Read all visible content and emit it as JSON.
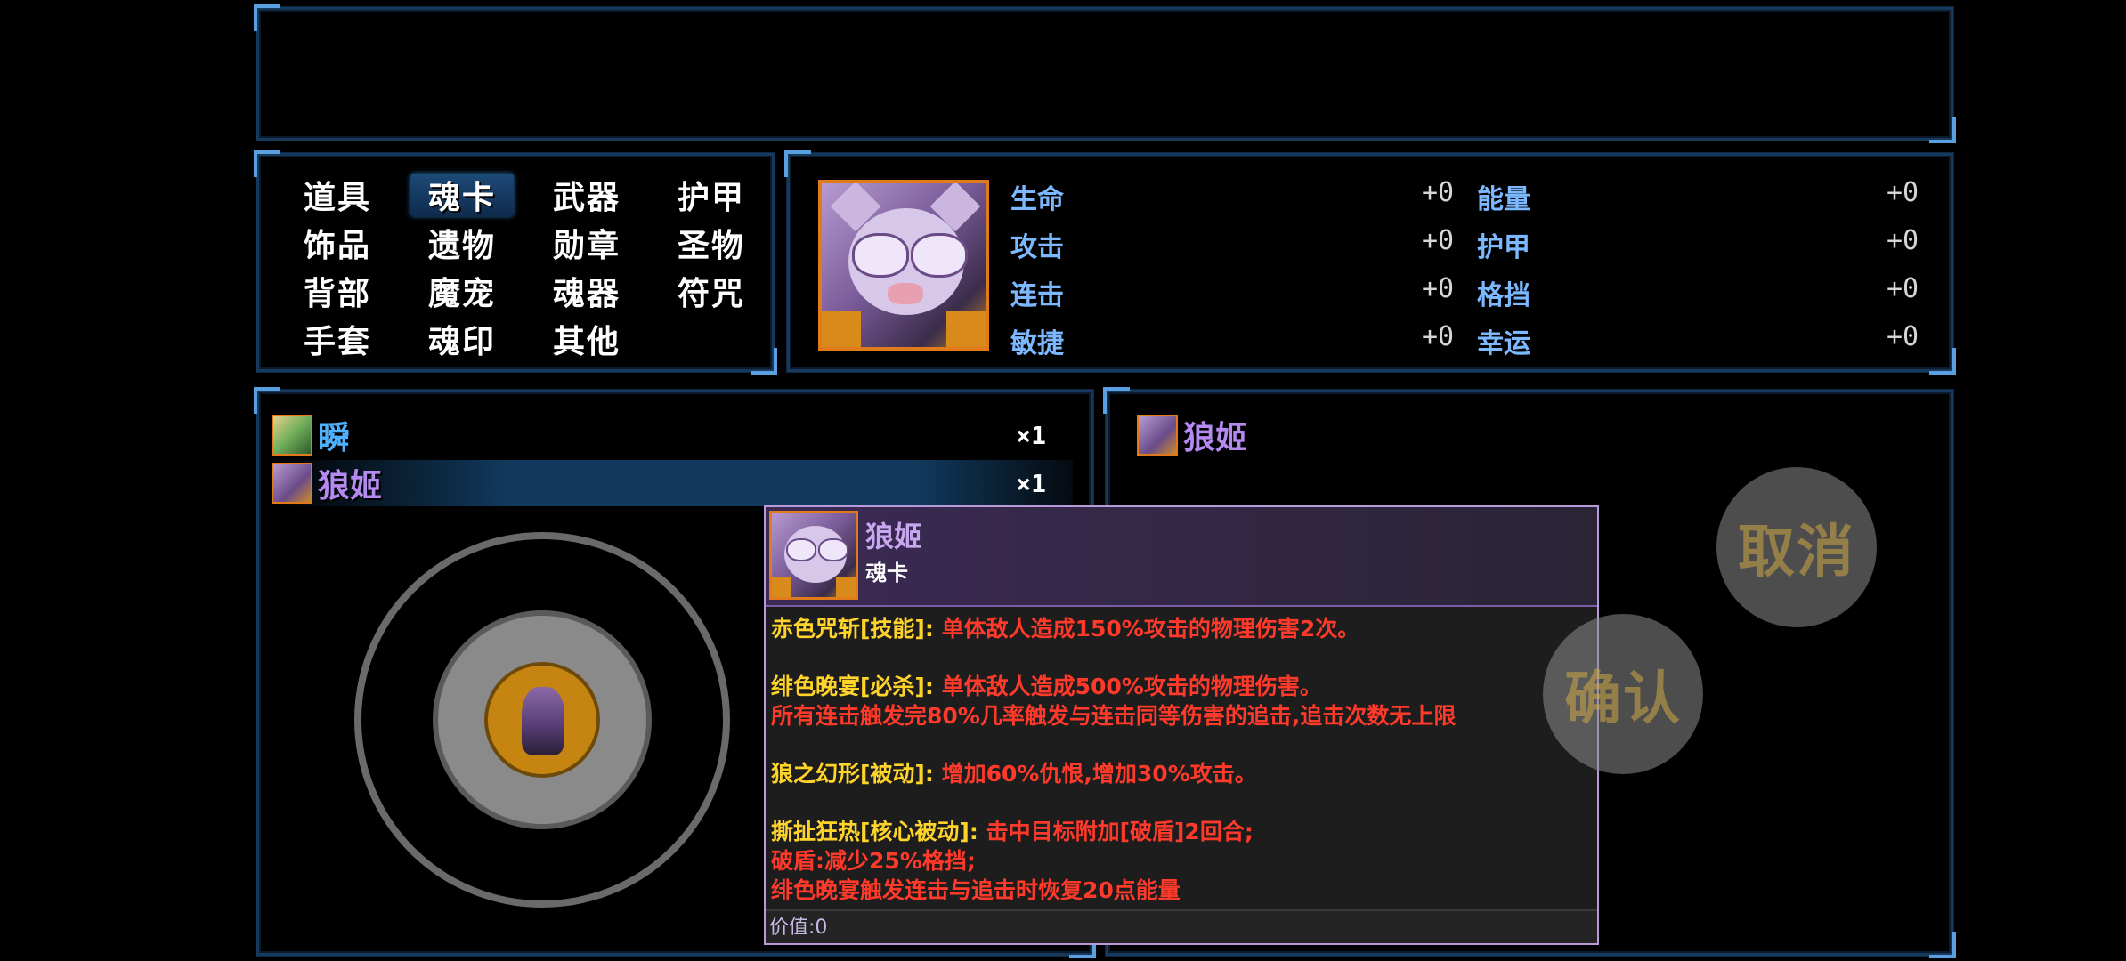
{
  "categories": [
    "道具",
    "魂卡",
    "武器",
    "护甲",
    "饰品",
    "遗物",
    "勋章",
    "圣物",
    "背部",
    "魔宠",
    "魂器",
    "符咒",
    "手套",
    "魂印",
    "其他"
  ],
  "active_category": "魂卡",
  "stats": {
    "left": [
      {
        "label": "生命",
        "value": "+0"
      },
      {
        "label": "攻击",
        "value": "+0"
      },
      {
        "label": "连击",
        "value": "+0"
      },
      {
        "label": "敏捷",
        "value": "+0"
      }
    ],
    "right": [
      {
        "label": "能量",
        "value": "+0"
      },
      {
        "label": "护甲",
        "value": "+0"
      },
      {
        "label": "格挡",
        "value": "+0"
      },
      {
        "label": "幸运",
        "value": "+0"
      }
    ]
  },
  "items": [
    {
      "name": "瞬",
      "count": "×1",
      "color": "#4fb0ff",
      "selected": false
    },
    {
      "name": "狼姬",
      "count": "×1",
      "color": "#b58af0",
      "selected": true
    }
  ],
  "equipped": {
    "name": "狼姬",
    "color": "#b58af0"
  },
  "tooltip": {
    "title": "狼姬",
    "type": "魂卡",
    "skills": [
      {
        "name": "赤色咒斩[技能]:",
        "lines": [
          "单体敌人造成150%攻击的物理伤害2次。"
        ]
      },
      {
        "name": "绯色晚宴[必杀]:",
        "lines": [
          "单体敌人造成500%攻击的物理伤害。",
          "所有连击触发完80%几率触发与连击同等伤害的追击,追击次数无上限"
        ]
      },
      {
        "name": "狼之幻形[被动]:",
        "lines": [
          "增加60%仇恨,增加30%攻击。"
        ]
      },
      {
        "name": "撕扯狂热[核心被动]:",
        "lines": [
          "击中目标附加[破盾]2回合;",
          "破盾:减少25%格挡;",
          "绯色晚宴触发连击与追击时恢复20点能量"
        ]
      }
    ],
    "value": "价值:0"
  },
  "buttons": {
    "cancel": "取消",
    "confirm": "确认"
  },
  "colors": {
    "panel_border": "#16395c",
    "accent": "#5aa0e0",
    "tooltip_border": "#b79ad8",
    "skill_name": "#ffd42a",
    "skill_desc": "#ff3a2a"
  }
}
